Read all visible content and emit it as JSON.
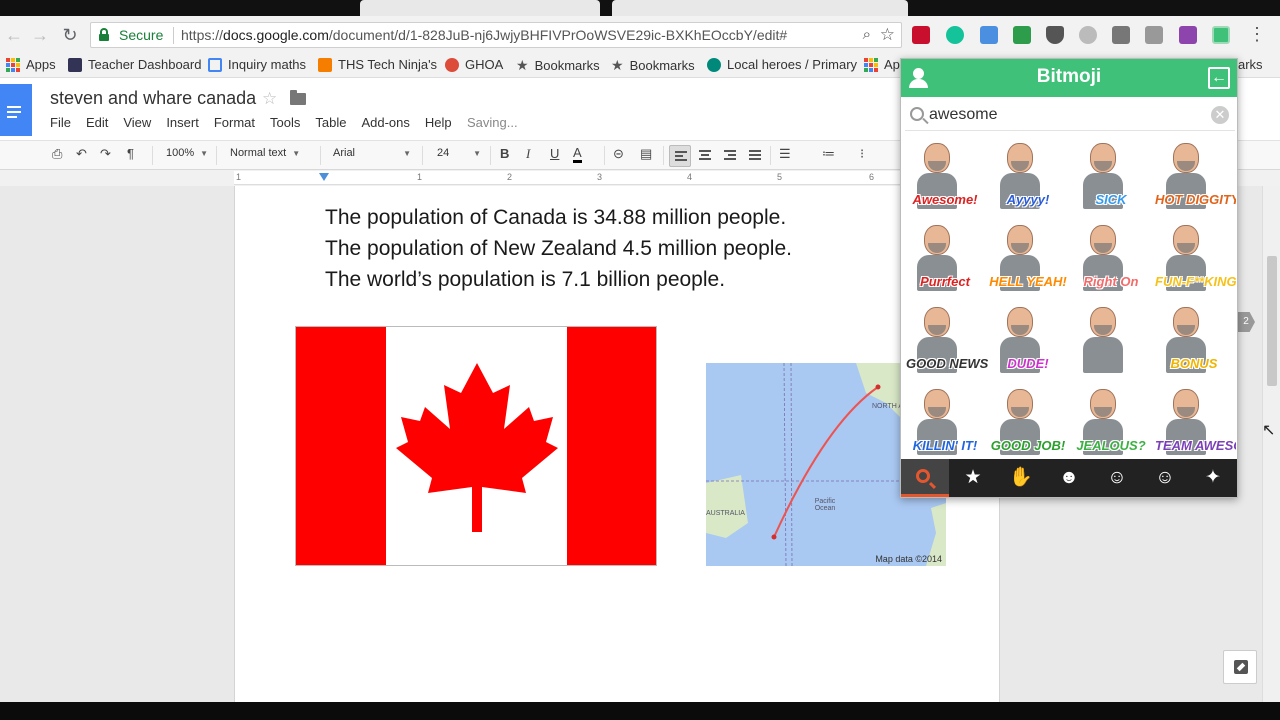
{
  "browser": {
    "secure_label": "Secure",
    "url_prefix": "https://",
    "url_host": "docs.google.com",
    "url_path": "/document/d/1-828JuB-nj6JwjyBHFIVPrOoWSVE29ic-BXKhEOccbY/edit#"
  },
  "bookmarks": [
    {
      "label": "Apps"
    },
    {
      "label": "Teacher Dashboard"
    },
    {
      "label": "Inquiry maths"
    },
    {
      "label": "THS Tech Ninja's"
    },
    {
      "label": "GHOA"
    },
    {
      "label": "Bookmarks"
    },
    {
      "label": "Bookmarks"
    },
    {
      "label": "Local heroes / Primary"
    },
    {
      "label": "Ap"
    },
    {
      "label": "arks"
    }
  ],
  "docs": {
    "title": "steven and whare canada",
    "menu": [
      "File",
      "Edit",
      "View",
      "Insert",
      "Format",
      "Tools",
      "Table",
      "Add-ons",
      "Help"
    ],
    "saving": "Saving...",
    "zoom": "100%",
    "style": "Normal text",
    "font": "Arial",
    "size": "24",
    "ruler_marks": [
      "1",
      "1",
      "2",
      "3",
      "4",
      "5",
      "6"
    ]
  },
  "content": {
    "lines": [
      "The population of Canada is 34.88 million people.",
      "The population of New Zealand 4.5 million people.",
      "The world’s population is 7.1 billion people."
    ],
    "map": {
      "label_north_america": "NORTH AMERICA",
      "label_pacific": "Pacific Ocean",
      "label_australia": "AUSTRALIA",
      "credit": "Map data ©2014"
    },
    "page_badge": "2"
  },
  "bitmoji": {
    "title": "Bitmoji",
    "search_value": "awesome",
    "stickers": [
      {
        "caption": "Awesome!",
        "color": "#d22"
      },
      {
        "caption": "Ayyyy!",
        "color": "#2a5bd8"
      },
      {
        "caption": "SICK",
        "color": "#3399ee"
      },
      {
        "caption": "HOT DIGGITY",
        "color": "#e0641b"
      },
      {
        "caption": "Purrfect",
        "color": "#d22"
      },
      {
        "caption": "HELL YEAH!",
        "color": "#ff8a00"
      },
      {
        "caption": "Right On",
        "color": "#f36b6b"
      },
      {
        "caption": "FUN-F**KING TASTIC",
        "color": "#f6c21a"
      },
      {
        "caption": "GOOD NEWS",
        "color": "#333"
      },
      {
        "caption": "DUDE!",
        "color": "#cc33cc"
      },
      {
        "caption": "",
        "color": "#333"
      },
      {
        "caption": "BONUS",
        "color": "#f0b400"
      },
      {
        "caption": "KILLIN' IT!",
        "color": "#2266dd"
      },
      {
        "caption": "GOOD JOB!",
        "color": "#2ca02c"
      },
      {
        "caption": "JEALOUS?",
        "color": "#3cb043"
      },
      {
        "caption": "TEAM AWESOME",
        "color": "#7b3fb8"
      }
    ]
  },
  "colors": {
    "bitmoji_green": "#40c17a",
    "docs_blue": "#4285f4",
    "canada_red": "#ff0000",
    "bitmoji_accent": "#e4572e"
  }
}
